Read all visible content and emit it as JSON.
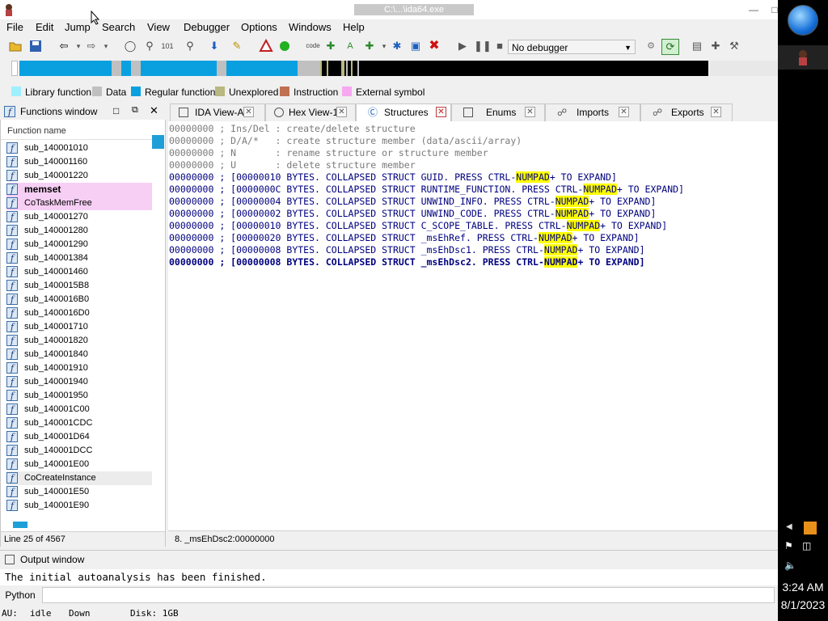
{
  "window": {
    "title": "C:\\...\\ida64.exe"
  },
  "menu": [
    "File",
    "Edit",
    "Jump",
    "Search",
    "View",
    "Debugger",
    "Options",
    "Windows",
    "Help"
  ],
  "toolbar": {
    "debugger_select": "No debugger"
  },
  "legend": [
    {
      "label": "Library function",
      "color": "#9ff0ff"
    },
    {
      "label": "Data",
      "color": "#c0c0c0"
    },
    {
      "label": "Regular function",
      "color": "#0aa0e0"
    },
    {
      "label": "Unexplored",
      "color": "#b8b880"
    },
    {
      "label": "Instruction",
      "color": "#c07050"
    },
    {
      "label": "External symbol",
      "color": "#f7a8f0"
    }
  ],
  "functions_window": {
    "title": "Functions window",
    "column_header": "Function name",
    "items": [
      {
        "name": "sub_140001010",
        "type": "regular"
      },
      {
        "name": "sub_140001160",
        "type": "regular"
      },
      {
        "name": "sub_140001220",
        "type": "regular"
      },
      {
        "name": "memset",
        "type": "external"
      },
      {
        "name": "CoTaskMemFree",
        "type": "external"
      },
      {
        "name": "sub_140001270",
        "type": "regular"
      },
      {
        "name": "sub_140001280",
        "type": "regular"
      },
      {
        "name": "sub_140001290",
        "type": "regular"
      },
      {
        "name": "sub_140001384",
        "type": "regular"
      },
      {
        "name": "sub_140001460",
        "type": "regular"
      },
      {
        "name": "sub_1400015B8",
        "type": "regular"
      },
      {
        "name": "sub_1400016B0",
        "type": "regular"
      },
      {
        "name": "sub_1400016D0",
        "type": "regular"
      },
      {
        "name": "sub_140001710",
        "type": "regular"
      },
      {
        "name": "sub_140001820",
        "type": "regular"
      },
      {
        "name": "sub_140001840",
        "type": "regular"
      },
      {
        "name": "sub_140001910",
        "type": "regular"
      },
      {
        "name": "sub_140001940",
        "type": "regular"
      },
      {
        "name": "sub_140001950",
        "type": "regular"
      },
      {
        "name": "sub_140001C00",
        "type": "regular"
      },
      {
        "name": "sub_140001CDC",
        "type": "regular"
      },
      {
        "name": "sub_140001D64",
        "type": "regular"
      },
      {
        "name": "sub_140001DCC",
        "type": "regular"
      },
      {
        "name": "sub_140001E00",
        "type": "regular"
      },
      {
        "name": "CoCreateInstance",
        "type": "selected"
      },
      {
        "name": "sub_140001E50",
        "type": "regular"
      },
      {
        "name": "sub_140001E90",
        "type": "regular"
      }
    ],
    "line_status": "Line 25 of 4567"
  },
  "tabs": [
    {
      "label": "IDA View-A",
      "active": false
    },
    {
      "label": "Hex View-1",
      "active": false
    },
    {
      "label": "Structures",
      "active": true
    },
    {
      "label": "Enums",
      "active": false
    },
    {
      "label": "Imports",
      "active": false
    },
    {
      "label": "Exports",
      "active": false
    }
  ],
  "structures": {
    "help_lines": [
      {
        "addr": "00000000",
        "text": " ; Ins/Del : create/delete structure"
      },
      {
        "addr": "00000000",
        "text": " ; D/A/*   : create structure member (data/ascii/array)"
      },
      {
        "addr": "00000000",
        "text": " ; N       : rename structure or structure member"
      },
      {
        "addr": "00000000",
        "text": " ; U       : delete structure member"
      }
    ],
    "struct_lines": [
      {
        "addr": "00000000",
        "pre": " ; [00000010 BYTES. COLLAPSED STRUCT GUID. PRESS CTRL-",
        "hl": "NUMPAD",
        "post": "+ TO EXPAND]"
      },
      {
        "addr": "00000000",
        "pre": " ; [0000000C BYTES. COLLAPSED STRUCT RUNTIME_FUNCTION. PRESS CTRL-",
        "hl": "NUMPAD",
        "post": "+ TO EXPAND]"
      },
      {
        "addr": "00000000",
        "pre": " ; [00000004 BYTES. COLLAPSED STRUCT UNWIND_INFO. PRESS CTRL-",
        "hl": "NUMPAD",
        "post": "+ TO EXPAND]"
      },
      {
        "addr": "00000000",
        "pre": " ; [00000002 BYTES. COLLAPSED STRUCT UNWIND_CODE. PRESS CTRL-",
        "hl": "NUMPAD",
        "post": "+ TO EXPAND]"
      },
      {
        "addr": "00000000",
        "pre": " ; [00000010 BYTES. COLLAPSED STRUCT C_SCOPE_TABLE. PRESS CTRL-",
        "hl": "NUMPAD",
        "post": "+ TO EXPAND]"
      },
      {
        "addr": "00000000",
        "pre": " ; [00000020 BYTES. COLLAPSED STRUCT _msEhRef. PRESS CTRL-",
        "hl": "NUMPAD",
        "post": "+ TO EXPAND]"
      },
      {
        "addr": "00000000",
        "pre": " ; [00000008 BYTES. COLLAPSED STRUCT _msEhDsc1. PRESS CTRL-",
        "hl": "NUMPAD",
        "post": "+ TO EXPAND]"
      },
      {
        "addr": "00000000",
        "pre": " ; [00000008 BYTES. COLLAPSED STRUCT _msEhDsc2. PRESS CTRL-",
        "hl": "NUMPAD",
        "post": "+ TO EXPAND]"
      }
    ],
    "status": "8. _msEhDsc2:00000000"
  },
  "output": {
    "title": "Output window",
    "text": "The initial autoanalysis has been finished.",
    "input_label": "Python"
  },
  "statusbar": {
    "au": "AU:",
    "au_state": "idle",
    "direction": "Down",
    "disk": "Disk: 1GB"
  },
  "taskbar": {
    "time": "3:24 AM",
    "date": "8/1/2023"
  }
}
